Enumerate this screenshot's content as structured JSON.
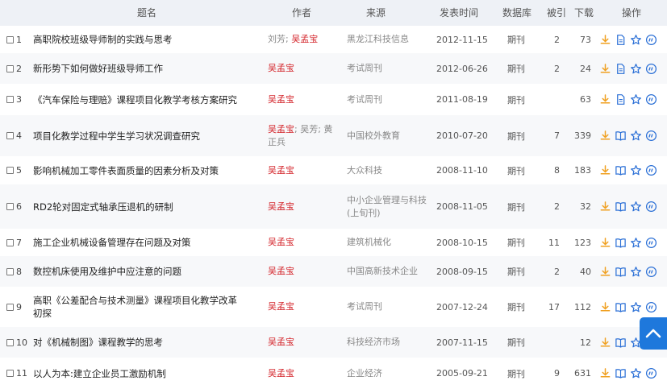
{
  "header": {
    "title": "题名",
    "author": "作者",
    "source": "来源",
    "date": "发表时间",
    "db": "数据库",
    "cite": "被引",
    "download": "下载",
    "ops": "操作"
  },
  "rows": [
    {
      "num": "1",
      "title": [
        "高职院校班级导师制的实践与思考"
      ],
      "authors": [
        {
          "t": "刘芳; ",
          "hl": false
        },
        {
          "t": "吴孟宝",
          "hl": true
        }
      ],
      "source": [
        "黑龙江科技信息"
      ],
      "date": "2012-11-15",
      "db": "期刊",
      "cite": "2",
      "download": "73",
      "read_icon": "document-icon"
    },
    {
      "num": "2",
      "title": [
        "新形势下如何做好班级导师工作"
      ],
      "authors": [
        {
          "t": "吴孟宝",
          "hl": true
        }
      ],
      "source": [
        "考试周刊"
      ],
      "date": "2012-06-26",
      "db": "期刊",
      "cite": "2",
      "download": "24",
      "read_icon": "document-icon"
    },
    {
      "num": "3",
      "title": [
        "《汽车保险与理赔》课程项目化教学考核方案研究"
      ],
      "authors": [
        {
          "t": "吴孟宝",
          "hl": true
        }
      ],
      "source": [
        "考试周刊"
      ],
      "date": "2011-08-19",
      "db": "期刊",
      "cite": "",
      "download": "63",
      "read_icon": "document-icon"
    },
    {
      "num": "4",
      "title": [
        "项目化教学过程中学生学习状况调查研究"
      ],
      "authors": [
        {
          "t": "吴孟宝",
          "hl": true
        },
        {
          "t": "; 吴芳; 黄正兵",
          "hl": false
        }
      ],
      "source": [
        "中国校外教育"
      ],
      "date": "2010-07-20",
      "db": "期刊",
      "cite": "7",
      "download": "339",
      "read_icon": "book-icon"
    },
    {
      "num": "5",
      "title": [
        "影响机械加工零件表面质量的因素分析及对策"
      ],
      "authors": [
        {
          "t": "吴孟宝",
          "hl": true
        }
      ],
      "source": [
        "大众科技"
      ],
      "date": "2008-11-10",
      "db": "期刊",
      "cite": "8",
      "download": "183",
      "read_icon": "book-icon"
    },
    {
      "num": "6",
      "title": [
        "RD2轮对固定式轴承压退机的研制"
      ],
      "authors": [
        {
          "t": "吴孟宝",
          "hl": true
        }
      ],
      "source": [
        "中小企业管理与科技",
        "(上旬刊)"
      ],
      "date": "2008-11-05",
      "db": "期刊",
      "cite": "2",
      "download": "32",
      "read_icon": "book-icon"
    },
    {
      "num": "7",
      "title": [
        "施工企业机械设备管理存在问题及对策"
      ],
      "authors": [
        {
          "t": "吴孟宝",
          "hl": true
        }
      ],
      "source": [
        "建筑机械化"
      ],
      "date": "2008-10-15",
      "db": "期刊",
      "cite": "11",
      "download": "123",
      "read_icon": "book-icon"
    },
    {
      "num": "8",
      "title": [
        "数控机床使用及维护中应注意的问题"
      ],
      "authors": [
        {
          "t": "吴孟宝",
          "hl": true
        }
      ],
      "source": [
        "中国高新技术企业"
      ],
      "date": "2008-09-15",
      "db": "期刊",
      "cite": "2",
      "download": "40",
      "read_icon": "book-icon"
    },
    {
      "num": "9",
      "title": [
        "高职《公差配合与技术测量》课程项目化教学改革",
        "初探"
      ],
      "authors": [
        {
          "t": "吴孟宝",
          "hl": true
        }
      ],
      "source": [
        "考试周刊"
      ],
      "date": "2007-12-24",
      "db": "期刊",
      "cite": "17",
      "download": "112",
      "read_icon": "book-icon"
    },
    {
      "num": "10",
      "title": [
        "对《机械制图》课程教学的思考"
      ],
      "authors": [
        {
          "t": "吴孟宝",
          "hl": true
        }
      ],
      "source": [
        "科技经济市场"
      ],
      "date": "2007-11-15",
      "db": "期刊",
      "cite": "",
      "download": "12",
      "read_icon": "book-icon"
    },
    {
      "num": "11",
      "title": [
        "以人为本:建立企业员工激励机制"
      ],
      "authors": [
        {
          "t": "吴孟宝",
          "hl": true
        }
      ],
      "source": [
        "企业经济"
      ],
      "date": "2005-09-21",
      "db": "期刊",
      "cite": "9",
      "download": "631",
      "read_icon": "book-icon"
    }
  ],
  "colors": {
    "header_bg": "#eef1f6",
    "alt_row_bg": "#f7f8fa",
    "author_highlight": "#d4262c",
    "download_icon": "#f0a020",
    "action_icon": "#2a6fd6",
    "back_to_top_bg": "#1e78dc"
  },
  "icons": {
    "download": "download-icon",
    "favorite": "star-icon",
    "quote": "quote-icon",
    "back_to_top": "chevron-up-icon"
  }
}
